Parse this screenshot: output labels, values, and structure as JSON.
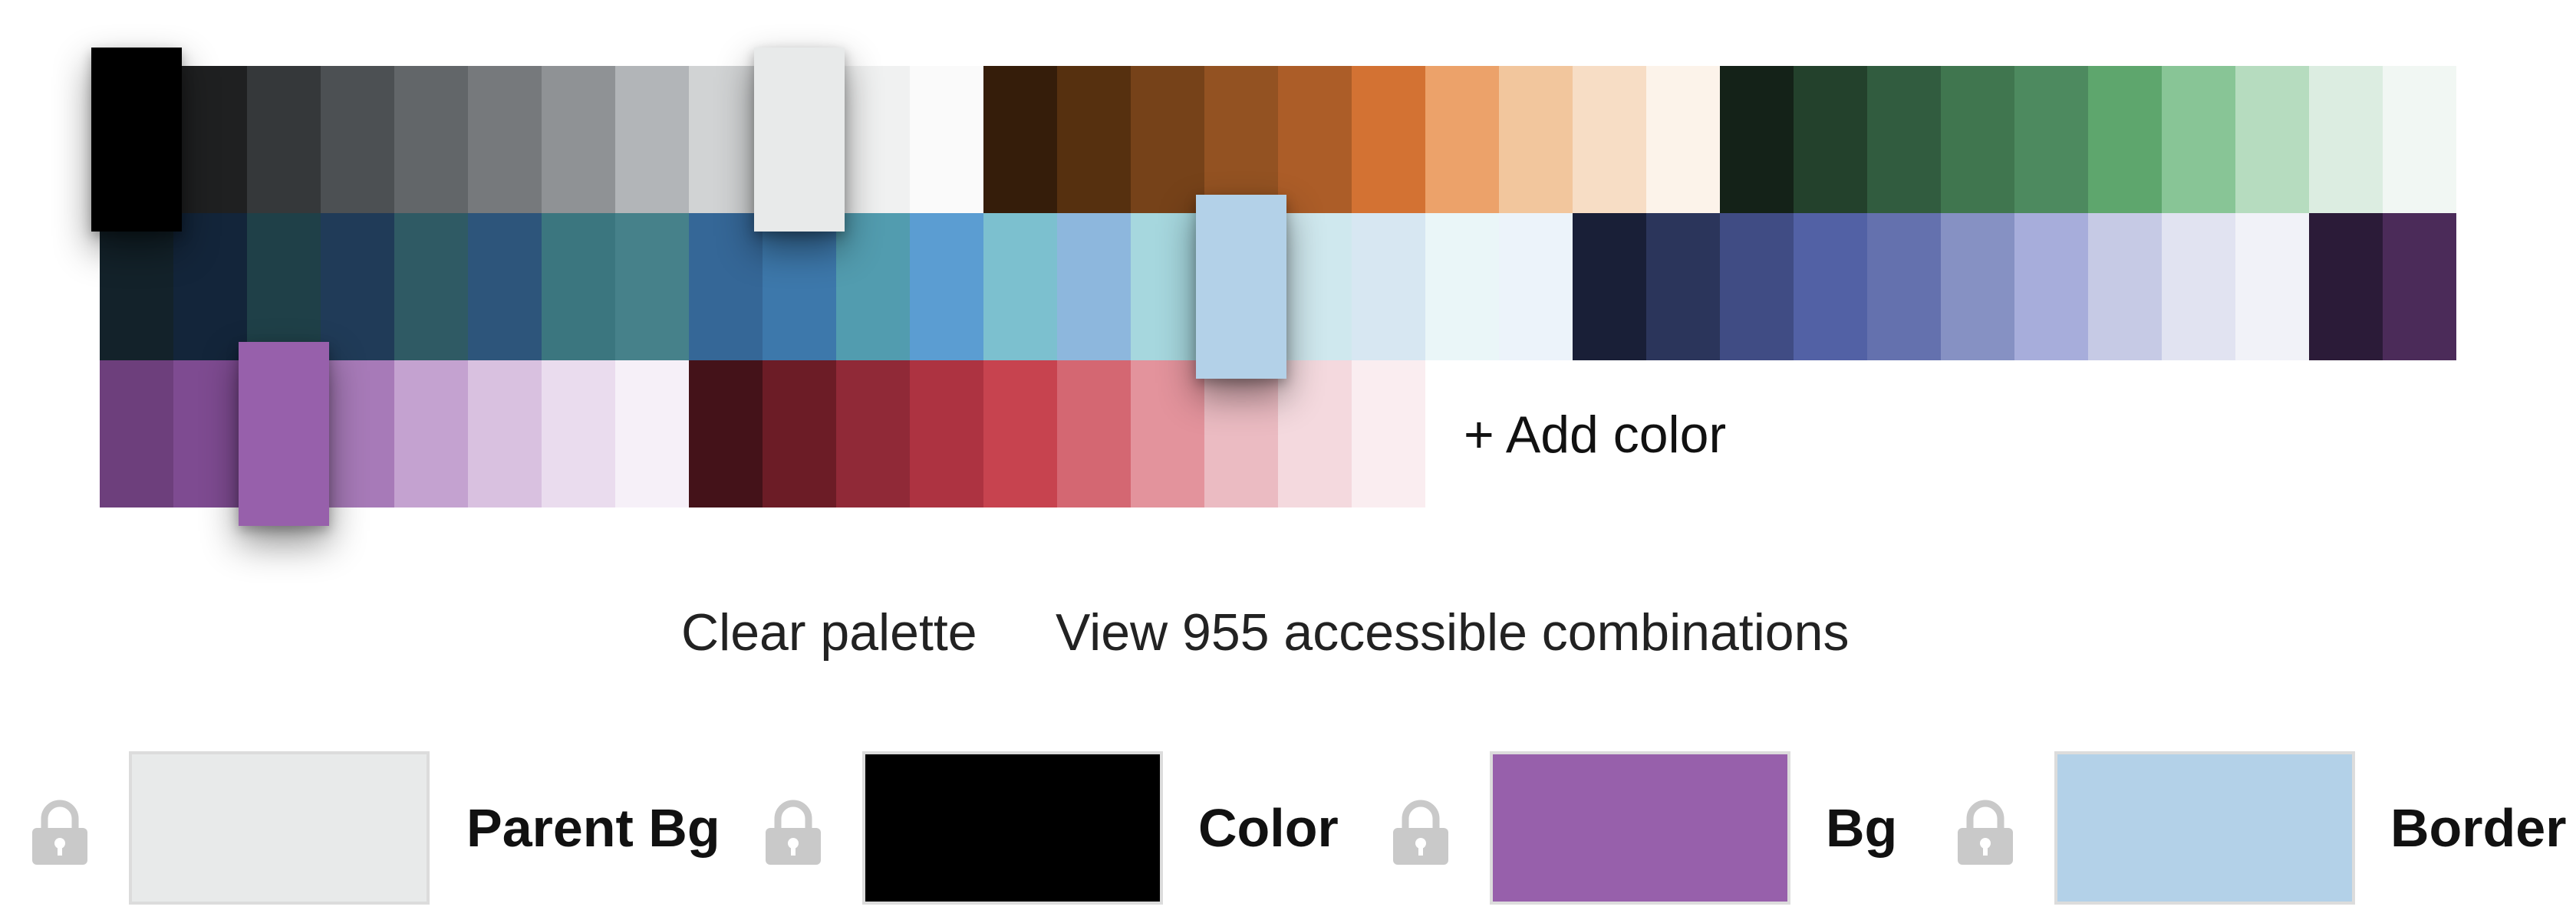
{
  "palette": {
    "rows": [
      [
        "#000000",
        "#1f2021",
        "#35383a",
        "#4c5053",
        "#626669",
        "#76797c",
        "#8f9295",
        "#b2b5b8",
        "#d1d3d4",
        "#e8eaea",
        "#f0f1f1",
        "#fafafa",
        "#351d0a",
        "#56300f",
        "#764219",
        "#935222",
        "#ac5d28",
        "#d37233",
        "#eca26a",
        "#f2c69d",
        "#f7ddc5",
        "#fcf3ea",
        "#142218",
        "#23412c",
        "#315c3f",
        "#40764f",
        "#4d8a5f",
        "#5ea66d",
        "#88c596",
        "#b6dcbf",
        "#dcede1",
        "#f1f7f3"
      ],
      [
        "#13222a",
        "#13253a",
        "#1f4048",
        "#203b58",
        "#2f5a64",
        "#2d557b",
        "#3b767f",
        "#46818a",
        "#356797",
        "#3d78ab",
        "#529caf",
        "#5b9dd2",
        "#7cc0cf",
        "#8db7dd",
        "#a6d7de",
        "#b3d1e8",
        "#cfe8ee",
        "#d7e7f2",
        "#eaf6f8",
        "#ecf3fa",
        "#191f37",
        "#2b355b",
        "#404c84",
        "#5261a5",
        "#6471ae",
        "#8691c3",
        "#a7addb",
        "#c6cae5",
        "#e1e3f1",
        "#f1f2f8",
        "#2b1b38",
        "#4b2b59"
      ],
      [
        "#6d3f7c",
        "#7e4b91",
        "#9760ab",
        "#a77ab8",
        "#c4a2d0",
        "#d9c1e0",
        "#eadcee",
        "#f6f0f8",
        "#441219",
        "#6c1c26",
        "#902937",
        "#ad3341",
        "#c7434f",
        "#d46772",
        "#e3939c",
        "#ebbbc2",
        "#f4d9de",
        "#faedf0"
      ]
    ],
    "add_color_label": "+ Add color"
  },
  "actions": {
    "clear_palette": "Clear palette",
    "view_combinations": "View 955 accessible combinations"
  },
  "slots": [
    {
      "label": "Parent Bg",
      "color": "#e8eaea",
      "lock_icon": "lock-icon"
    },
    {
      "label": "Color",
      "color": "#000000",
      "lock_icon": "lock-icon"
    },
    {
      "label": "Bg",
      "color": "#9760ab",
      "lock_icon": "lock-icon"
    },
    {
      "label": "Border",
      "color": "#b3d1e8",
      "lock_icon": "lock-icon"
    }
  ],
  "selected_swatches": [
    "#000000",
    "#e8eaea",
    "#9760ab",
    "#b3d1e8"
  ]
}
